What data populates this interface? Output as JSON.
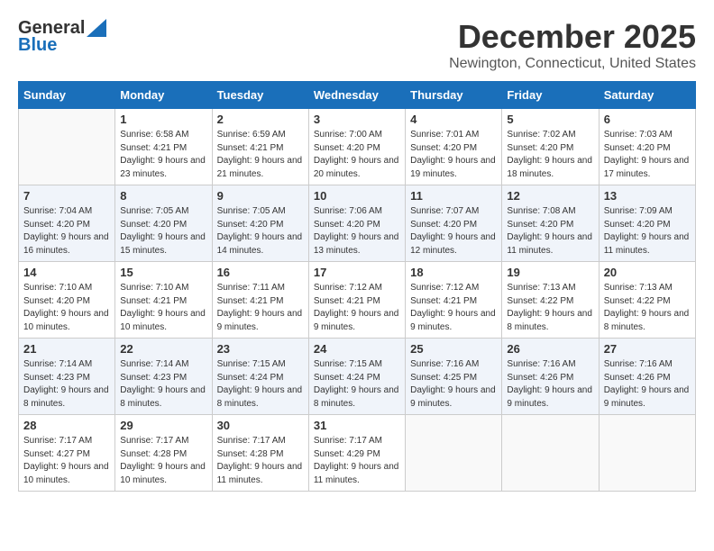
{
  "header": {
    "logo_line1": "General",
    "logo_line2": "Blue",
    "month": "December 2025",
    "location": "Newington, Connecticut, United States"
  },
  "days_of_week": [
    "Sunday",
    "Monday",
    "Tuesday",
    "Wednesday",
    "Thursday",
    "Friday",
    "Saturday"
  ],
  "weeks": [
    [
      {
        "num": "",
        "sunrise": "",
        "sunset": "",
        "daylight": ""
      },
      {
        "num": "1",
        "sunrise": "Sunrise: 6:58 AM",
        "sunset": "Sunset: 4:21 PM",
        "daylight": "Daylight: 9 hours and 23 minutes."
      },
      {
        "num": "2",
        "sunrise": "Sunrise: 6:59 AM",
        "sunset": "Sunset: 4:21 PM",
        "daylight": "Daylight: 9 hours and 21 minutes."
      },
      {
        "num": "3",
        "sunrise": "Sunrise: 7:00 AM",
        "sunset": "Sunset: 4:20 PM",
        "daylight": "Daylight: 9 hours and 20 minutes."
      },
      {
        "num": "4",
        "sunrise": "Sunrise: 7:01 AM",
        "sunset": "Sunset: 4:20 PM",
        "daylight": "Daylight: 9 hours and 19 minutes."
      },
      {
        "num": "5",
        "sunrise": "Sunrise: 7:02 AM",
        "sunset": "Sunset: 4:20 PM",
        "daylight": "Daylight: 9 hours and 18 minutes."
      },
      {
        "num": "6",
        "sunrise": "Sunrise: 7:03 AM",
        "sunset": "Sunset: 4:20 PM",
        "daylight": "Daylight: 9 hours and 17 minutes."
      }
    ],
    [
      {
        "num": "7",
        "sunrise": "Sunrise: 7:04 AM",
        "sunset": "Sunset: 4:20 PM",
        "daylight": "Daylight: 9 hours and 16 minutes."
      },
      {
        "num": "8",
        "sunrise": "Sunrise: 7:05 AM",
        "sunset": "Sunset: 4:20 PM",
        "daylight": "Daylight: 9 hours and 15 minutes."
      },
      {
        "num": "9",
        "sunrise": "Sunrise: 7:05 AM",
        "sunset": "Sunset: 4:20 PM",
        "daylight": "Daylight: 9 hours and 14 minutes."
      },
      {
        "num": "10",
        "sunrise": "Sunrise: 7:06 AM",
        "sunset": "Sunset: 4:20 PM",
        "daylight": "Daylight: 9 hours and 13 minutes."
      },
      {
        "num": "11",
        "sunrise": "Sunrise: 7:07 AM",
        "sunset": "Sunset: 4:20 PM",
        "daylight": "Daylight: 9 hours and 12 minutes."
      },
      {
        "num": "12",
        "sunrise": "Sunrise: 7:08 AM",
        "sunset": "Sunset: 4:20 PM",
        "daylight": "Daylight: 9 hours and 11 minutes."
      },
      {
        "num": "13",
        "sunrise": "Sunrise: 7:09 AM",
        "sunset": "Sunset: 4:20 PM",
        "daylight": "Daylight: 9 hours and 11 minutes."
      }
    ],
    [
      {
        "num": "14",
        "sunrise": "Sunrise: 7:10 AM",
        "sunset": "Sunset: 4:20 PM",
        "daylight": "Daylight: 9 hours and 10 minutes."
      },
      {
        "num": "15",
        "sunrise": "Sunrise: 7:10 AM",
        "sunset": "Sunset: 4:21 PM",
        "daylight": "Daylight: 9 hours and 10 minutes."
      },
      {
        "num": "16",
        "sunrise": "Sunrise: 7:11 AM",
        "sunset": "Sunset: 4:21 PM",
        "daylight": "Daylight: 9 hours and 9 minutes."
      },
      {
        "num": "17",
        "sunrise": "Sunrise: 7:12 AM",
        "sunset": "Sunset: 4:21 PM",
        "daylight": "Daylight: 9 hours and 9 minutes."
      },
      {
        "num": "18",
        "sunrise": "Sunrise: 7:12 AM",
        "sunset": "Sunset: 4:21 PM",
        "daylight": "Daylight: 9 hours and 9 minutes."
      },
      {
        "num": "19",
        "sunrise": "Sunrise: 7:13 AM",
        "sunset": "Sunset: 4:22 PM",
        "daylight": "Daylight: 9 hours and 8 minutes."
      },
      {
        "num": "20",
        "sunrise": "Sunrise: 7:13 AM",
        "sunset": "Sunset: 4:22 PM",
        "daylight": "Daylight: 9 hours and 8 minutes."
      }
    ],
    [
      {
        "num": "21",
        "sunrise": "Sunrise: 7:14 AM",
        "sunset": "Sunset: 4:23 PM",
        "daylight": "Daylight: 9 hours and 8 minutes."
      },
      {
        "num": "22",
        "sunrise": "Sunrise: 7:14 AM",
        "sunset": "Sunset: 4:23 PM",
        "daylight": "Daylight: 9 hours and 8 minutes."
      },
      {
        "num": "23",
        "sunrise": "Sunrise: 7:15 AM",
        "sunset": "Sunset: 4:24 PM",
        "daylight": "Daylight: 9 hours and 8 minutes."
      },
      {
        "num": "24",
        "sunrise": "Sunrise: 7:15 AM",
        "sunset": "Sunset: 4:24 PM",
        "daylight": "Daylight: 9 hours and 8 minutes."
      },
      {
        "num": "25",
        "sunrise": "Sunrise: 7:16 AM",
        "sunset": "Sunset: 4:25 PM",
        "daylight": "Daylight: 9 hours and 9 minutes."
      },
      {
        "num": "26",
        "sunrise": "Sunrise: 7:16 AM",
        "sunset": "Sunset: 4:26 PM",
        "daylight": "Daylight: 9 hours and 9 minutes."
      },
      {
        "num": "27",
        "sunrise": "Sunrise: 7:16 AM",
        "sunset": "Sunset: 4:26 PM",
        "daylight": "Daylight: 9 hours and 9 minutes."
      }
    ],
    [
      {
        "num": "28",
        "sunrise": "Sunrise: 7:17 AM",
        "sunset": "Sunset: 4:27 PM",
        "daylight": "Daylight: 9 hours and 10 minutes."
      },
      {
        "num": "29",
        "sunrise": "Sunrise: 7:17 AM",
        "sunset": "Sunset: 4:28 PM",
        "daylight": "Daylight: 9 hours and 10 minutes."
      },
      {
        "num": "30",
        "sunrise": "Sunrise: 7:17 AM",
        "sunset": "Sunset: 4:28 PM",
        "daylight": "Daylight: 9 hours and 11 minutes."
      },
      {
        "num": "31",
        "sunrise": "Sunrise: 7:17 AM",
        "sunset": "Sunset: 4:29 PM",
        "daylight": "Daylight: 9 hours and 11 minutes."
      },
      {
        "num": "",
        "sunrise": "",
        "sunset": "",
        "daylight": ""
      },
      {
        "num": "",
        "sunrise": "",
        "sunset": "",
        "daylight": ""
      },
      {
        "num": "",
        "sunrise": "",
        "sunset": "",
        "daylight": ""
      }
    ]
  ]
}
